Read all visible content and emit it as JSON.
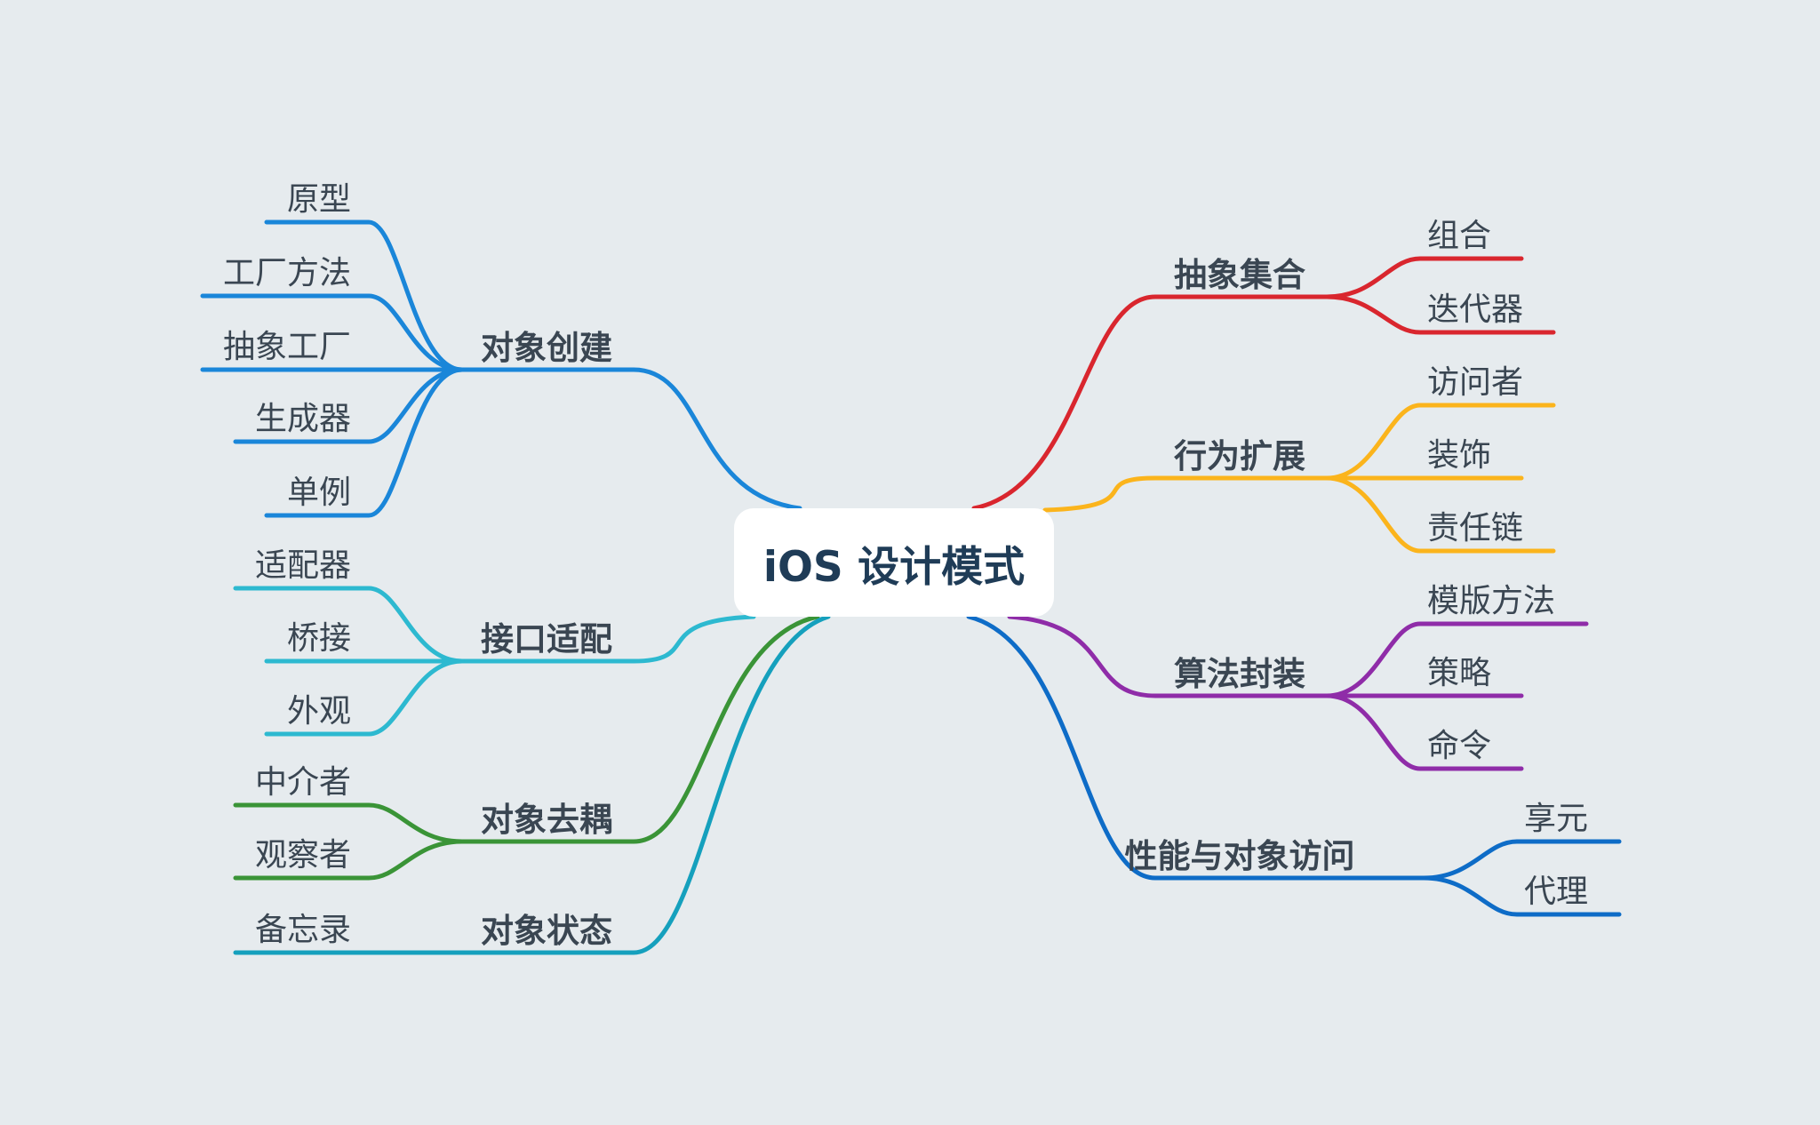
{
  "central_topic": "iOS 设计模式",
  "branches": [
    {
      "label": "对象创建",
      "color": "#1a86d9",
      "children": [
        "原型",
        "工厂方法",
        "抽象工厂",
        "生成器",
        "单例"
      ]
    },
    {
      "label": "接口适配",
      "color": "#2db9d0",
      "children": [
        "适配器",
        "桥接",
        "外观"
      ]
    },
    {
      "label": "对象去耦",
      "color": "#3a9437",
      "children": [
        "中介者",
        "观察者"
      ]
    },
    {
      "label": "对象状态",
      "color": "#15a0bd",
      "children": [
        "备忘录"
      ]
    },
    {
      "label": "抽象集合",
      "color": "#d9262e",
      "children": [
        "组合",
        "迭代器"
      ]
    },
    {
      "label": "行为扩展",
      "color": "#fbb41c",
      "children": [
        "访问者",
        "装饰",
        "责任链"
      ]
    },
    {
      "label": "算法封装",
      "color": "#8f2ca8",
      "children": [
        "模版方法",
        "策略",
        "命令"
      ]
    },
    {
      "label": "性能与对象访问",
      "color": "#0e6cc7",
      "children": [
        "享元",
        "代理"
      ]
    }
  ]
}
